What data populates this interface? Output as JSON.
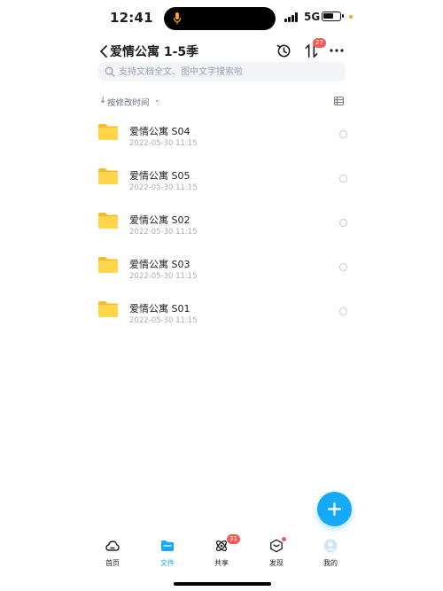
{
  "status_bar": {
    "time": "12:41",
    "network": "5G"
  },
  "nav": {
    "title": "爱情公寓 1-5季",
    "transfer_badge": "27"
  },
  "search": {
    "placeholder": "支持文档全文、图中文字搜索啦"
  },
  "sort": {
    "label": "按修改时间"
  },
  "files": [
    {
      "name": "爱情公寓 S04",
      "date": "2022-05-30 11:15"
    },
    {
      "name": "爱情公寓 S05",
      "date": "2022-05-30 11:15"
    },
    {
      "name": "爱情公寓 S02",
      "date": "2022-05-30 11:15"
    },
    {
      "name": "爱情公寓 S03",
      "date": "2022-05-30 11:15"
    },
    {
      "name": "爱情公寓 S01",
      "date": "2022-05-30 11:15"
    }
  ],
  "tabs": [
    {
      "label": "首页",
      "icon": "cloud-home-icon"
    },
    {
      "label": "文件",
      "icon": "folder-tab-icon"
    },
    {
      "label": "共享",
      "icon": "share-icon",
      "badge": "31"
    },
    {
      "label": "发现",
      "icon": "discover-icon"
    },
    {
      "label": "我的",
      "icon": "avatar-icon"
    }
  ],
  "colors": {
    "accent": "#16a9f5",
    "badge": "#f25a5a",
    "folder": "#ffcc33"
  }
}
